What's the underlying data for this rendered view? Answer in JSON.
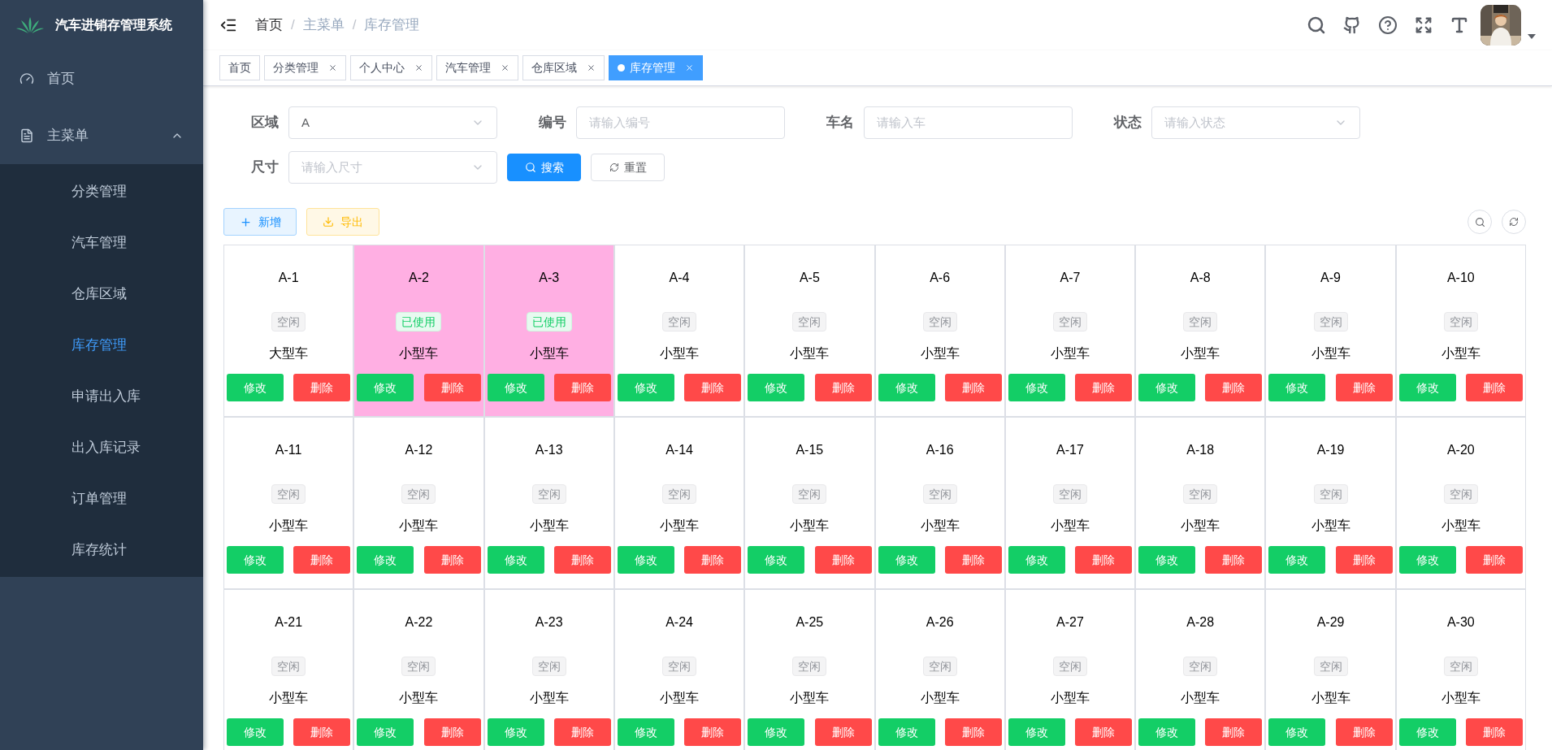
{
  "sidebar": {
    "title": "汽车进销存管理系统",
    "items": [
      {
        "label": "首页",
        "kind": "dashboard",
        "selected": false
      },
      {
        "label": "主菜单",
        "kind": "document",
        "selected": false,
        "expanded": true,
        "children": [
          {
            "label": "分类管理",
            "selected": false
          },
          {
            "label": "汽车管理",
            "selected": false
          },
          {
            "label": "仓库区域",
            "selected": false
          },
          {
            "label": "库存管理",
            "selected": true
          },
          {
            "label": "申请出入库",
            "selected": false
          },
          {
            "label": "出入库记录",
            "selected": false
          },
          {
            "label": "订单管理",
            "selected": false
          },
          {
            "label": "库存统计",
            "selected": false
          }
        ]
      }
    ]
  },
  "breadcrumb": {
    "items": [
      "首页",
      "主菜单",
      "库存管理"
    ],
    "separators": [
      "/",
      "/"
    ]
  },
  "tabs": [
    {
      "label": "首页",
      "closable": false,
      "selected": false
    },
    {
      "label": "分类管理",
      "closable": true,
      "selected": false
    },
    {
      "label": "个人中心",
      "closable": true,
      "selected": false
    },
    {
      "label": "汽车管理",
      "closable": true,
      "selected": false
    },
    {
      "label": "仓库区域",
      "closable": true,
      "selected": false
    },
    {
      "label": "库存管理",
      "closable": true,
      "selected": true
    }
  ],
  "filters": [
    {
      "label": "区域",
      "kind": "select",
      "value": "A"
    },
    {
      "label": "编号",
      "kind": "input",
      "placeholder": "请输入编号"
    },
    {
      "label": "车名",
      "kind": "input",
      "placeholder": "请输入车"
    },
    {
      "label": "状态",
      "kind": "select",
      "placeholder": "请输入状态"
    },
    {
      "label": "尺寸",
      "kind": "select",
      "placeholder": "请输入尺寸"
    }
  ],
  "filter_buttons": [
    {
      "label": "搜索",
      "kind": "primary"
    },
    {
      "label": "重置",
      "kind": "reset"
    }
  ],
  "toolbar": [
    {
      "label": "新增",
      "kind": "add"
    },
    {
      "label": "导出",
      "kind": "export"
    }
  ],
  "cards": [
    {
      "code": "A-1",
      "status": "空闲",
      "kind": "free",
      "car_type": "大型车",
      "actions": [
        "修改",
        "删除"
      ]
    },
    {
      "code": "A-2",
      "status": "已使用",
      "kind": "used",
      "car_type": "小型车",
      "actions": [
        "修改",
        "删除"
      ]
    },
    {
      "code": "A-3",
      "status": "已使用",
      "kind": "used",
      "car_type": "小型车",
      "actions": [
        "修改",
        "删除"
      ]
    },
    {
      "code": "A-4",
      "status": "空闲",
      "kind": "free",
      "car_type": "小型车",
      "actions": [
        "修改",
        "删除"
      ]
    },
    {
      "code": "A-5",
      "status": "空闲",
      "kind": "free",
      "car_type": "小型车",
      "actions": [
        "修改",
        "删除"
      ]
    },
    {
      "code": "A-6",
      "status": "空闲",
      "kind": "free",
      "car_type": "小型车",
      "actions": [
        "修改",
        "删除"
      ]
    },
    {
      "code": "A-7",
      "status": "空闲",
      "kind": "free",
      "car_type": "小型车",
      "actions": [
        "修改",
        "删除"
      ]
    },
    {
      "code": "A-8",
      "status": "空闲",
      "kind": "free",
      "car_type": "小型车",
      "actions": [
        "修改",
        "删除"
      ]
    },
    {
      "code": "A-9",
      "status": "空闲",
      "kind": "free",
      "car_type": "小型车",
      "actions": [
        "修改",
        "删除"
      ]
    },
    {
      "code": "A-10",
      "status": "空闲",
      "kind": "free",
      "car_type": "小型车",
      "actions": [
        "修改",
        "删除"
      ]
    },
    {
      "code": "A-11",
      "status": "空闲",
      "kind": "free",
      "car_type": "小型车",
      "actions": [
        "修改",
        "删除"
      ]
    },
    {
      "code": "A-12",
      "status": "空闲",
      "kind": "free",
      "car_type": "小型车",
      "actions": [
        "修改",
        "删除"
      ]
    },
    {
      "code": "A-13",
      "status": "空闲",
      "kind": "free",
      "car_type": "小型车",
      "actions": [
        "修改",
        "删除"
      ]
    },
    {
      "code": "A-14",
      "status": "空闲",
      "kind": "free",
      "car_type": "小型车",
      "actions": [
        "修改",
        "删除"
      ]
    },
    {
      "code": "A-15",
      "status": "空闲",
      "kind": "free",
      "car_type": "小型车",
      "actions": [
        "修改",
        "删除"
      ]
    },
    {
      "code": "A-16",
      "status": "空闲",
      "kind": "free",
      "car_type": "小型车",
      "actions": [
        "修改",
        "删除"
      ]
    },
    {
      "code": "A-17",
      "status": "空闲",
      "kind": "free",
      "car_type": "小型车",
      "actions": [
        "修改",
        "删除"
      ]
    },
    {
      "code": "A-18",
      "status": "空闲",
      "kind": "free",
      "car_type": "小型车",
      "actions": [
        "修改",
        "删除"
      ]
    },
    {
      "code": "A-19",
      "status": "空闲",
      "kind": "free",
      "car_type": "小型车",
      "actions": [
        "修改",
        "删除"
      ]
    },
    {
      "code": "A-20",
      "status": "空闲",
      "kind": "free",
      "car_type": "小型车",
      "actions": [
        "修改",
        "删除"
      ]
    },
    {
      "code": "A-21",
      "status": "空闲",
      "kind": "free",
      "car_type": "小型车",
      "actions": [
        "修改",
        "删除"
      ]
    },
    {
      "code": "A-22",
      "status": "空闲",
      "kind": "free",
      "car_type": "小型车",
      "actions": [
        "修改",
        "删除"
      ]
    },
    {
      "code": "A-23",
      "status": "空闲",
      "kind": "free",
      "car_type": "小型车",
      "actions": [
        "修改",
        "删除"
      ]
    },
    {
      "code": "A-24",
      "status": "空闲",
      "kind": "free",
      "car_type": "小型车",
      "actions": [
        "修改",
        "删除"
      ]
    },
    {
      "code": "A-25",
      "status": "空闲",
      "kind": "free",
      "car_type": "小型车",
      "actions": [
        "修改",
        "删除"
      ]
    },
    {
      "code": "A-26",
      "status": "空闲",
      "kind": "free",
      "car_type": "小型车",
      "actions": [
        "修改",
        "删除"
      ]
    },
    {
      "code": "A-27",
      "status": "空闲",
      "kind": "free",
      "car_type": "小型车",
      "actions": [
        "修改",
        "删除"
      ]
    },
    {
      "code": "A-28",
      "status": "空闲",
      "kind": "free",
      "car_type": "小型车",
      "actions": [
        "修改",
        "删除"
      ]
    },
    {
      "code": "A-29",
      "status": "空闲",
      "kind": "free",
      "car_type": "小型车",
      "actions": [
        "修改",
        "删除"
      ]
    },
    {
      "code": "A-30",
      "status": "空闲",
      "kind": "free",
      "car_type": "小型车",
      "actions": [
        "修改",
        "删除"
      ]
    }
  ]
}
